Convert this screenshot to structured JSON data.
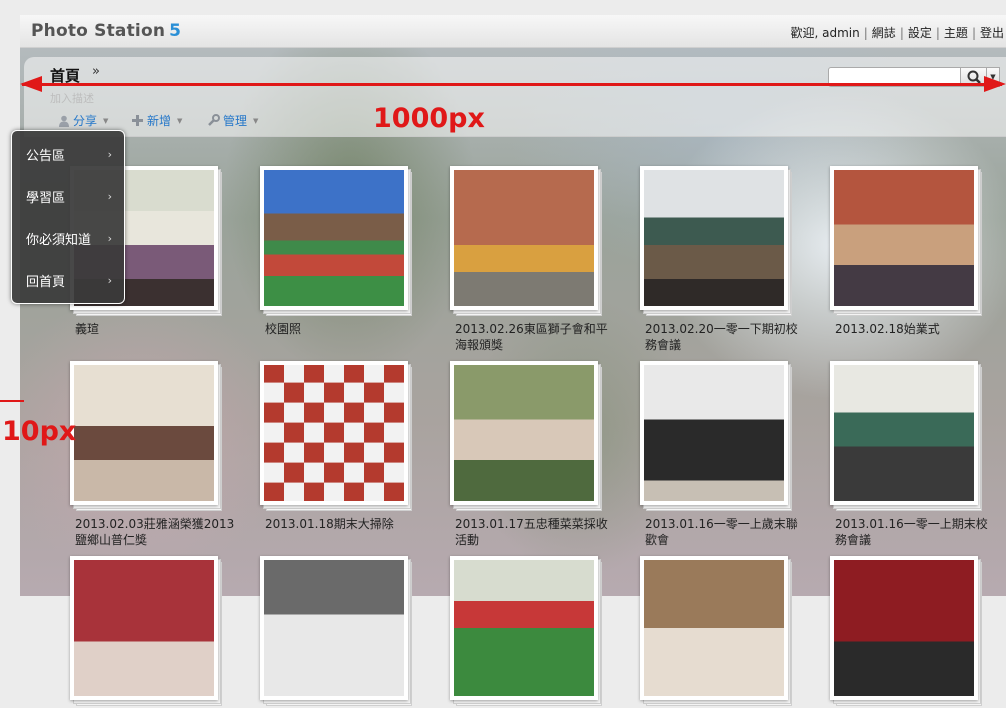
{
  "header": {
    "logo_text": "Photo Station",
    "logo_version": "5",
    "top_links": [
      "歡迎, admin",
      "網誌",
      "設定",
      "主題",
      "登出"
    ]
  },
  "breadcrumb": {
    "home": "首頁",
    "arrow": "»"
  },
  "description": "加入描述",
  "toolbar": {
    "share": "分享",
    "add": "新增",
    "manage": "管理"
  },
  "menu": {
    "items": [
      "公告區",
      "學習區",
      "你必須知道",
      "回首頁"
    ]
  },
  "annotations": {
    "width_label": "1000px",
    "margin_label": "10px"
  },
  "albums": [
    {
      "title": "義瑄"
    },
    {
      "title": "校園照"
    },
    {
      "title": "2013.02.26東區獅子會和平海報頒獎"
    },
    {
      "title": "2013.02.20一零一下期初校務會議"
    },
    {
      "title": "2013.02.18始業式"
    },
    {
      "title": "2013.02.03莊雅涵榮獲2013鹽鄉山普仁獎"
    },
    {
      "title": "2013.01.18期末大掃除"
    },
    {
      "title": "2013.01.17五忠種菜菜採收活動"
    },
    {
      "title": "2013.01.16一零一上歲末聯歡會"
    },
    {
      "title": "2013.01.16一零一上期末校務會議"
    }
  ],
  "colors": {
    "accent": "#2a8fd6",
    "annotation": "#e01818",
    "link": "#2577c9"
  }
}
